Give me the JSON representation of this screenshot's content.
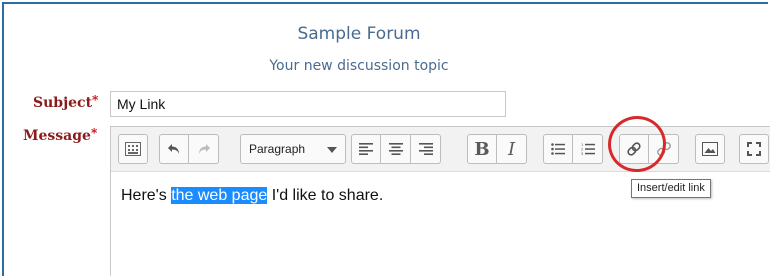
{
  "forum": {
    "title": "Sample Forum",
    "subtitle": "Your new discussion topic"
  },
  "form": {
    "subject_label": "Subject",
    "message_label": "Message",
    "required_mark": "*",
    "subject_value": "My Link"
  },
  "toolbar": {
    "format_select_value": "Paragraph",
    "buttons": [
      "toolbar-toggle-icon",
      "undo-icon",
      "redo-icon",
      "align-left-icon",
      "align-center-icon",
      "align-right-icon",
      "bold-icon",
      "italic-icon",
      "unordered-list-icon",
      "ordered-list-icon",
      "link-icon",
      "unlink-icon",
      "image-icon",
      "fullscreen-icon"
    ]
  },
  "editor": {
    "text_before": "Here's ",
    "text_selected": "the web page",
    "text_after": " I'd like to share."
  },
  "tooltip": {
    "text": "Insert/edit link"
  },
  "colors": {
    "frame_border": "#2e6da4",
    "label": "#8b1a1a",
    "required": "#cc0000",
    "selection": "#1a8cff",
    "highlight_circle": "#d8282b"
  }
}
